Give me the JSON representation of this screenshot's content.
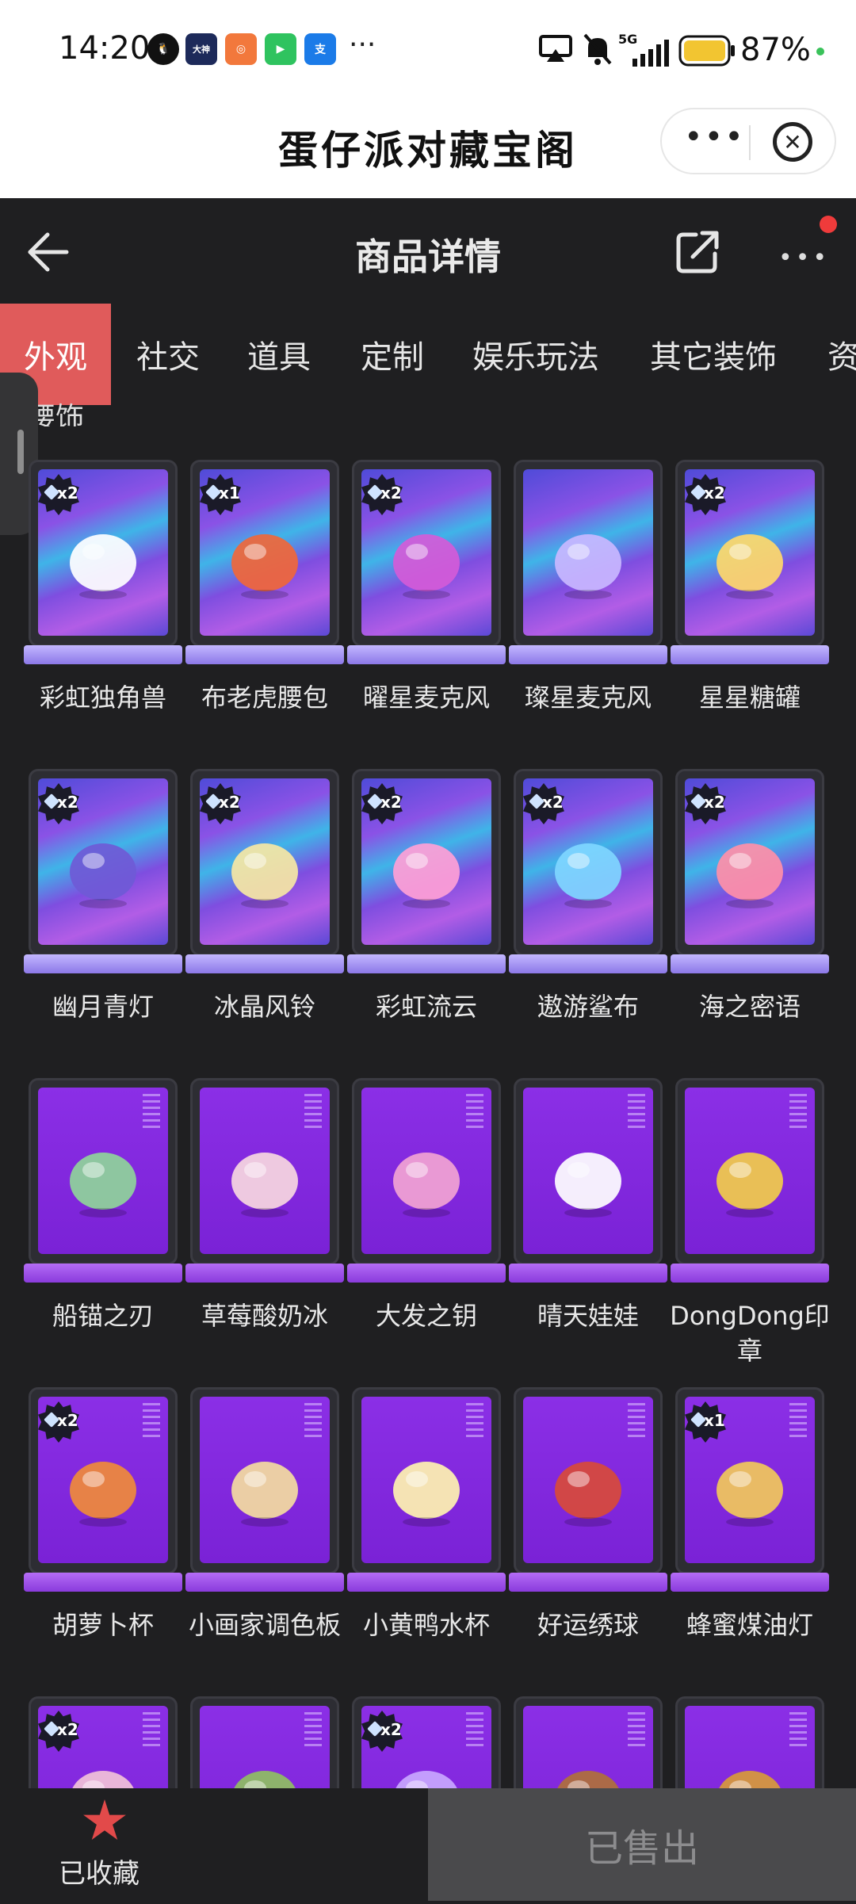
{
  "status_bar": {
    "time": "14:20",
    "app_icons": [
      "qq-icon",
      "dashen-icon",
      "app-icon",
      "video-icon",
      "alipay-icon"
    ],
    "overflow": "···",
    "network": "5G",
    "battery_percent": "87%"
  },
  "mini_program": {
    "title": "蛋仔派对藏宝阁",
    "more": "•••",
    "close_icon": "close-circle-icon"
  },
  "app_bar": {
    "title": "商品详情",
    "back_icon": "arrow-left-icon",
    "share_icon": "share-icon",
    "menu": "•••"
  },
  "tabs": [
    {
      "label": "外观",
      "active": true
    },
    {
      "label": "社交"
    },
    {
      "label": "道具"
    },
    {
      "label": "定制"
    },
    {
      "label": "娱乐玩法"
    },
    {
      "label": "其它装饰"
    },
    {
      "label": "资"
    }
  ],
  "section_label": "腰饰",
  "items": [
    {
      "name": "彩虹独角兽",
      "badge": "x2",
      "style": "holo"
    },
    {
      "name": "布老虎腰包",
      "badge": "x1",
      "style": "holo"
    },
    {
      "name": "曜星麦克风",
      "badge": "x2",
      "style": "holo"
    },
    {
      "name": "璨星麦克风",
      "badge": "",
      "style": "holo"
    },
    {
      "name": "星星糖罐",
      "badge": "x2",
      "style": "holo"
    },
    {
      "name": "幽月青灯",
      "badge": "x2",
      "style": "holo"
    },
    {
      "name": "冰晶风铃",
      "badge": "x2",
      "style": "holo"
    },
    {
      "name": "彩虹流云",
      "badge": "x2",
      "style": "holo"
    },
    {
      "name": "遨游鲨布",
      "badge": "x2",
      "style": "holo"
    },
    {
      "name": "海之密语",
      "badge": "x2",
      "style": "holo"
    },
    {
      "name": "船锚之刃",
      "badge": "",
      "style": "purple"
    },
    {
      "name": "草莓酸奶冰",
      "badge": "",
      "style": "purple"
    },
    {
      "name": "大发之钥",
      "badge": "",
      "style": "purple"
    },
    {
      "name": "晴天娃娃",
      "badge": "",
      "style": "purple"
    },
    {
      "name": "DongDong印章",
      "badge": "",
      "style": "purple"
    },
    {
      "name": "胡萝卜杯",
      "badge": "x2",
      "style": "purple"
    },
    {
      "name": "小画家调色板",
      "badge": "",
      "style": "purple"
    },
    {
      "name": "小黄鸭水杯",
      "badge": "",
      "style": "purple"
    },
    {
      "name": "好运绣球",
      "badge": "",
      "style": "purple"
    },
    {
      "name": "蜂蜜煤油灯",
      "badge": "x1",
      "style": "purple"
    },
    {
      "name": "",
      "badge": "x2",
      "style": "purple"
    },
    {
      "name": "",
      "badge": "",
      "style": "purple"
    },
    {
      "name": "",
      "badge": "x2",
      "style": "purple"
    },
    {
      "name": "",
      "badge": "",
      "style": "purple"
    },
    {
      "name": "",
      "badge": "",
      "style": "purple"
    }
  ],
  "bottom_bar": {
    "favorite_label": "已收藏",
    "favorite_icon": "star-icon",
    "sold_label": "已售出"
  },
  "colors": {
    "active_tab": "#e05b5b",
    "favorite_star": "#e24a4a",
    "background": "#1f1f21"
  }
}
